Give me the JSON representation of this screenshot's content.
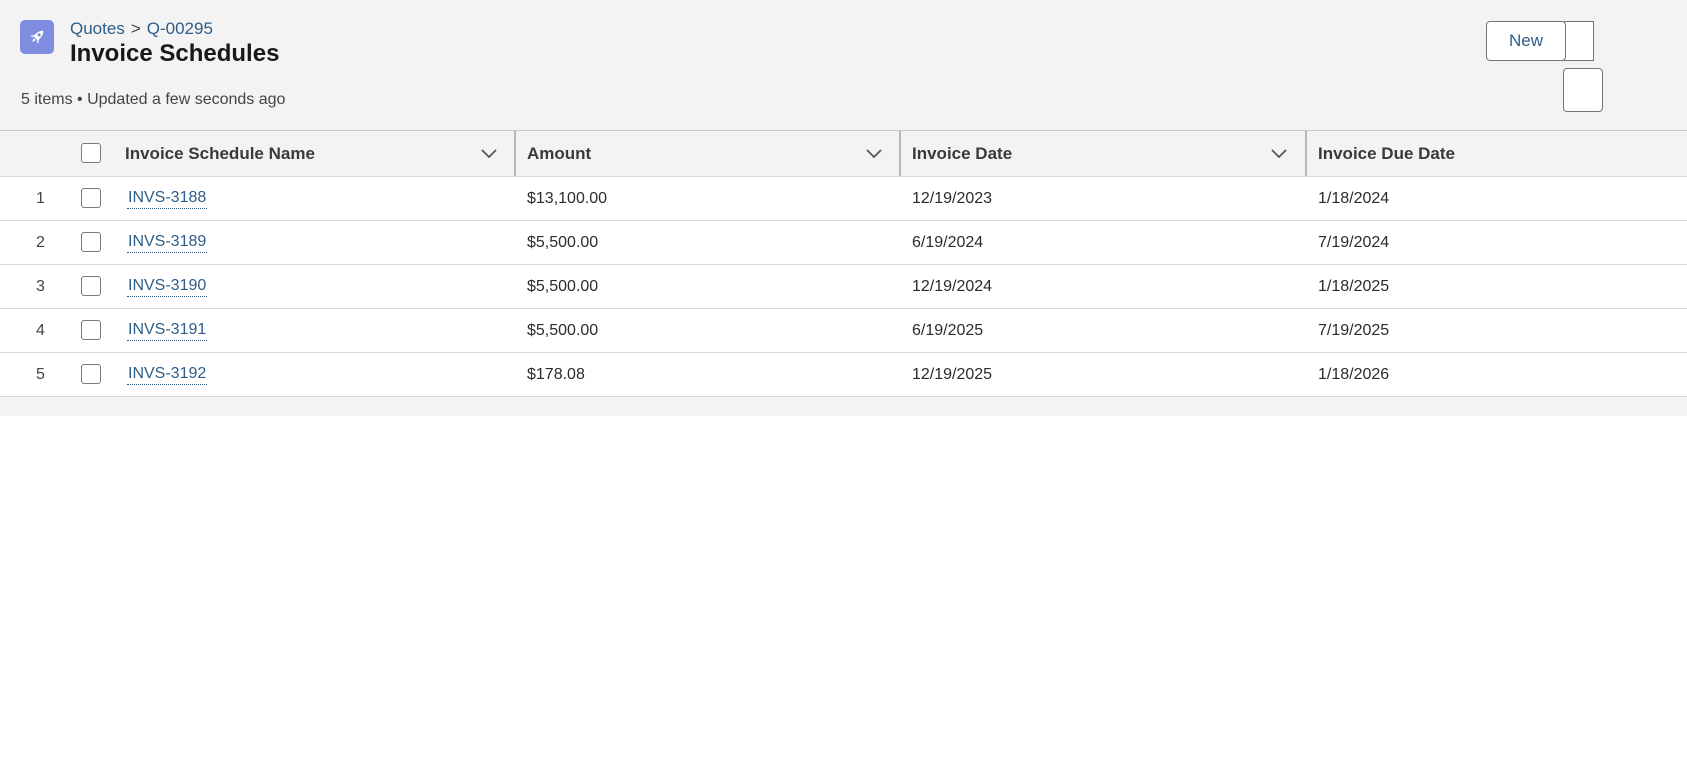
{
  "header": {
    "breadcrumb": {
      "parent": "Quotes",
      "separator": ">",
      "record": "Q-00295"
    },
    "title": "Invoice Schedules",
    "meta": "5 items • Updated a few seconds ago",
    "icon": "rocket-icon",
    "accent_color": "#7f8de1"
  },
  "actions": {
    "new_label": "New"
  },
  "table": {
    "columns": [
      {
        "label": "Invoice Schedule Name"
      },
      {
        "label": "Amount"
      },
      {
        "label": "Invoice Date"
      },
      {
        "label": "Invoice Due Date"
      }
    ],
    "rows": [
      {
        "num": "1",
        "name": "INVS-3188",
        "amount": "$13,100.00",
        "invoice_date": "12/19/2023",
        "due_date": "1/18/2024"
      },
      {
        "num": "2",
        "name": "INVS-3189",
        "amount": "$5,500.00",
        "invoice_date": "6/19/2024",
        "due_date": "7/19/2024"
      },
      {
        "num": "3",
        "name": "INVS-3190",
        "amount": "$5,500.00",
        "invoice_date": "12/19/2024",
        "due_date": "1/18/2025"
      },
      {
        "num": "4",
        "name": "INVS-3191",
        "amount": "$5,500.00",
        "invoice_date": "6/19/2025",
        "due_date": "7/19/2025"
      },
      {
        "num": "5",
        "name": "INVS-3192",
        "amount": "$178.08",
        "invoice_date": "12/19/2025",
        "due_date": "1/18/2026"
      }
    ]
  }
}
